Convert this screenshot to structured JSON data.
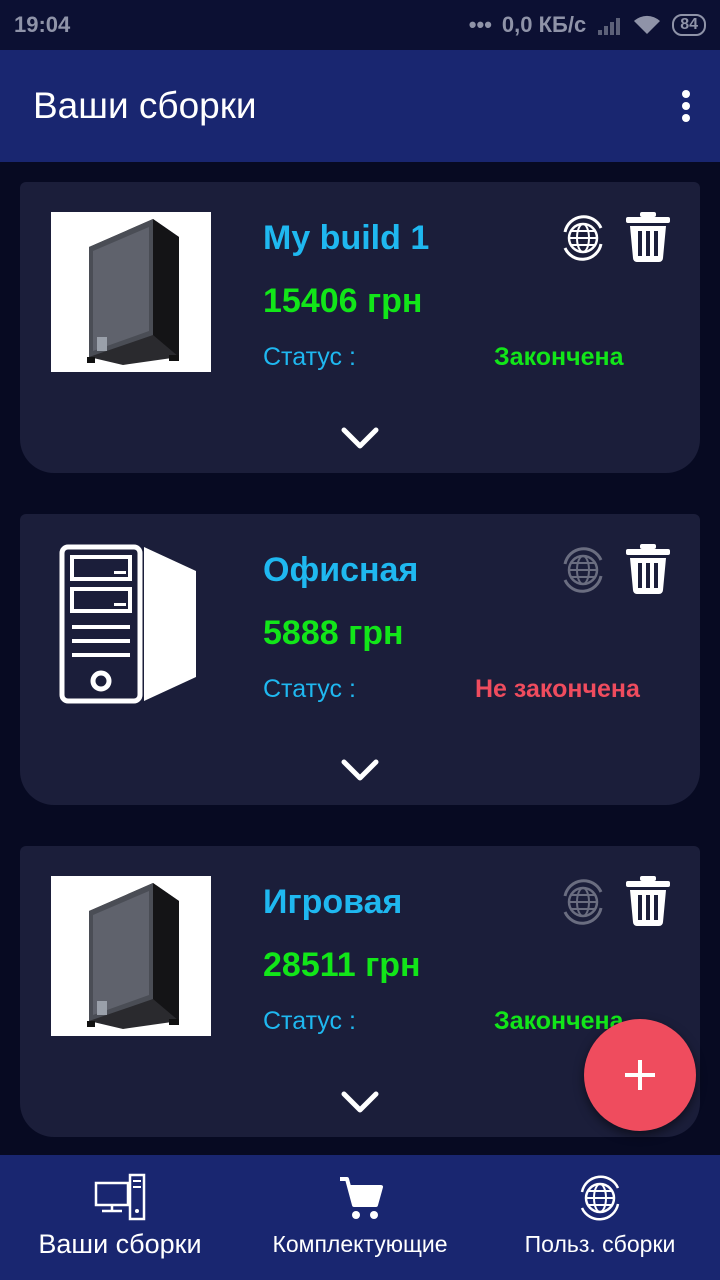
{
  "status_bar": {
    "time": "19:04",
    "network": "0,0 КБ/с",
    "battery": "84"
  },
  "app_bar": {
    "title": "Ваши сборки"
  },
  "builds": [
    {
      "name": "My build 1",
      "price": "15406 грн",
      "status_label": "Статус :",
      "status": "Закончена",
      "image": "pc-case-photo",
      "shared": true
    },
    {
      "name": "Офисная",
      "price": "5888 грн",
      "status_label": "Статус :",
      "status": "Не закончена",
      "image": "pc-outline-icon",
      "shared": false
    },
    {
      "name": "Игровая",
      "price": "28511 грн",
      "status_label": "Статус :",
      "status": "Закончена",
      "image": "pc-case-photo",
      "shared": false
    }
  ],
  "bottom_nav": [
    {
      "label": "Ваши сборки",
      "icon": "computer-icon"
    },
    {
      "label": "Комплектующие",
      "icon": "cart-icon"
    },
    {
      "label": "Польз. сборки",
      "icon": "globe-icon"
    }
  ],
  "colors": {
    "background": "#070a22",
    "app_bar": "#192670",
    "card": "#1b1e3a",
    "name": "#1fb8f0",
    "price": "#12e619",
    "status_done": "#12e619",
    "status_not_done": "#ef4c5e",
    "fab": "#ef4c5e"
  }
}
